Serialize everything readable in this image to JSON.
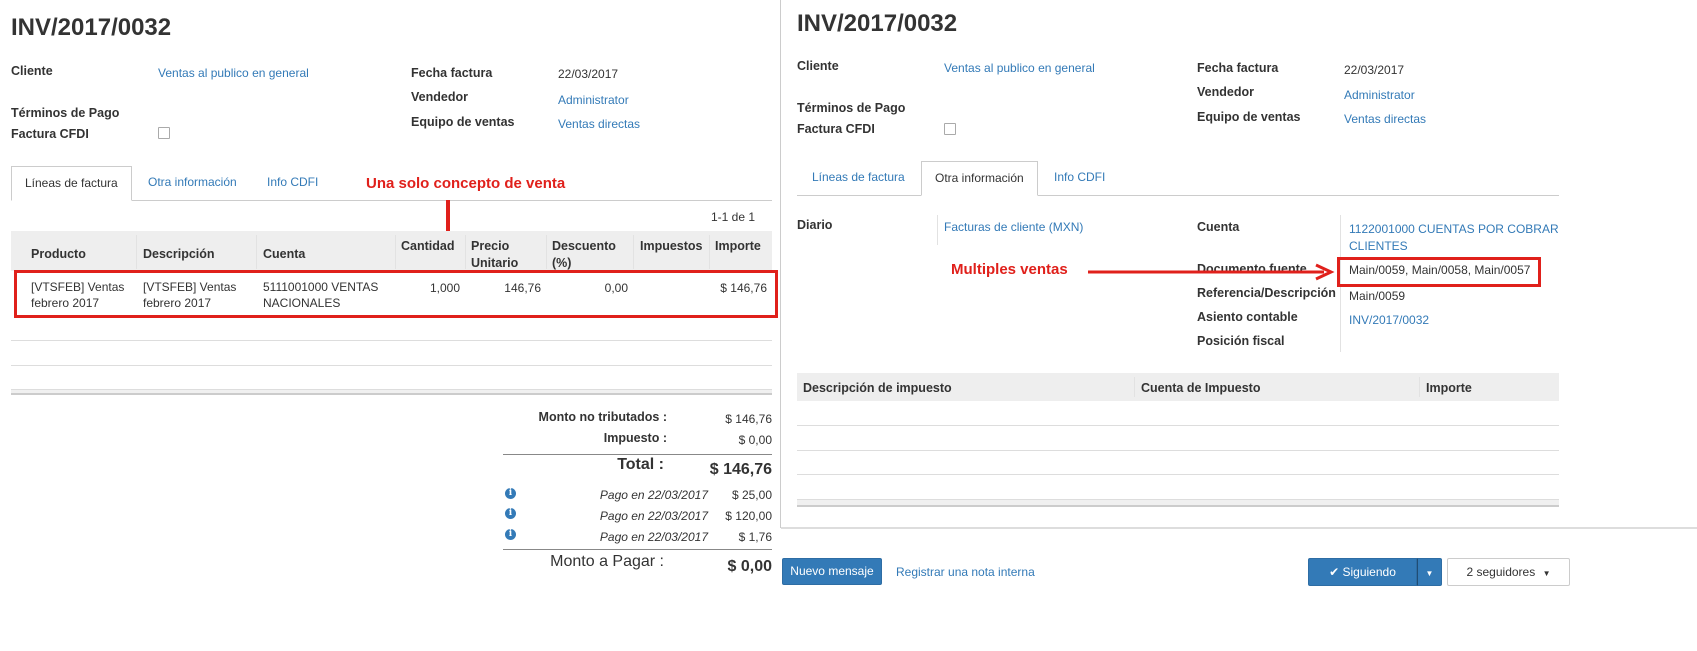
{
  "left": {
    "title": "INV/2017/0032",
    "cliente_label": "Cliente",
    "cliente_value": "Ventas al publico en general",
    "terminos_label": "Términos de Pago",
    "cfdi_label": "Factura CFDI",
    "fecha_label": "Fecha factura",
    "fecha_value": "22/03/2017",
    "vendedor_label": "Vendedor",
    "vendedor_value": "Administrator",
    "equipo_label": "Equipo de ventas",
    "equipo_value": "Ventas directas",
    "tabs": [
      "Líneas de factura",
      "Otra información",
      "Info CDFI"
    ],
    "pager": "1-1 de 1",
    "columns": [
      "Producto",
      "Descripción",
      "Cuenta",
      "Cantidad",
      "Precio Unitario",
      "Descuento (%)",
      "Impuestos",
      "Importe"
    ],
    "row": {
      "producto": "[VTSFEB] Ventas febrero 2017",
      "descripcion": "[VTSFEB] Ventas febrero 2017",
      "cuenta": "5111001000 VENTAS NACIONALES",
      "cantidad": "1,000",
      "precio": "146,76",
      "descuento": "0,00",
      "impuestos": "",
      "importe": "$ 146,76"
    },
    "annotation": "Una solo concepto de venta",
    "totals": {
      "no_trib_label": "Monto no tributados :",
      "no_trib_value": "$ 146,76",
      "impuesto_label": "Impuesto :",
      "impuesto_value": "$ 0,00",
      "total_label": "Total :",
      "total_value": "$ 146,76",
      "pagos": [
        {
          "label": "Pago en 22/03/2017",
          "value": "$ 25,00"
        },
        {
          "label": "Pago en 22/03/2017",
          "value": "$ 120,00"
        },
        {
          "label": "Pago en 22/03/2017",
          "value": "$ 1,76"
        }
      ],
      "monto_label": "Monto a Pagar :",
      "monto_value": "$ 0,00"
    }
  },
  "right": {
    "title": "INV/2017/0032",
    "cliente_label": "Cliente",
    "cliente_value": "Ventas al publico en general",
    "terminos_label": "Términos de Pago",
    "cfdi_label": "Factura CFDI",
    "fecha_label": "Fecha factura",
    "fecha_value": "22/03/2017",
    "vendedor_label": "Vendedor",
    "vendedor_value": "Administrator",
    "equipo_label": "Equipo de ventas",
    "equipo_value": "Ventas directas",
    "tabs": [
      "Líneas de factura",
      "Otra información",
      "Info CDFI"
    ],
    "diario_label": "Diario",
    "diario_value": "Facturas de cliente (MXN)",
    "cuenta_label": "Cuenta",
    "cuenta_value_1": "1122001000 CUENTAS POR COBRAR",
    "cuenta_value_2": "CLIENTES",
    "doc_label": "Documento fuente",
    "doc_value": "Main/0059, Main/0058, Main/0057",
    "ref_label": "Referencia/Descripción",
    "ref_value": "Main/0059",
    "asiento_label": "Asiento contable",
    "asiento_value": "INV/2017/0032",
    "posicion_label": "Posición fiscal",
    "annotation": "Multiples ventas",
    "tax_columns": [
      "Descripción de impuesto",
      "Cuenta de Impuesto",
      "Importe"
    ]
  },
  "chatter": {
    "nuevo_mensaje": "Nuevo mensaje",
    "nota_interna": "Registrar una nota interna",
    "siguiendo": "Siguiendo",
    "seguidores": "2 seguidores"
  },
  "colors": {
    "accent": "#337ab7",
    "annotation": "#e0201b"
  }
}
